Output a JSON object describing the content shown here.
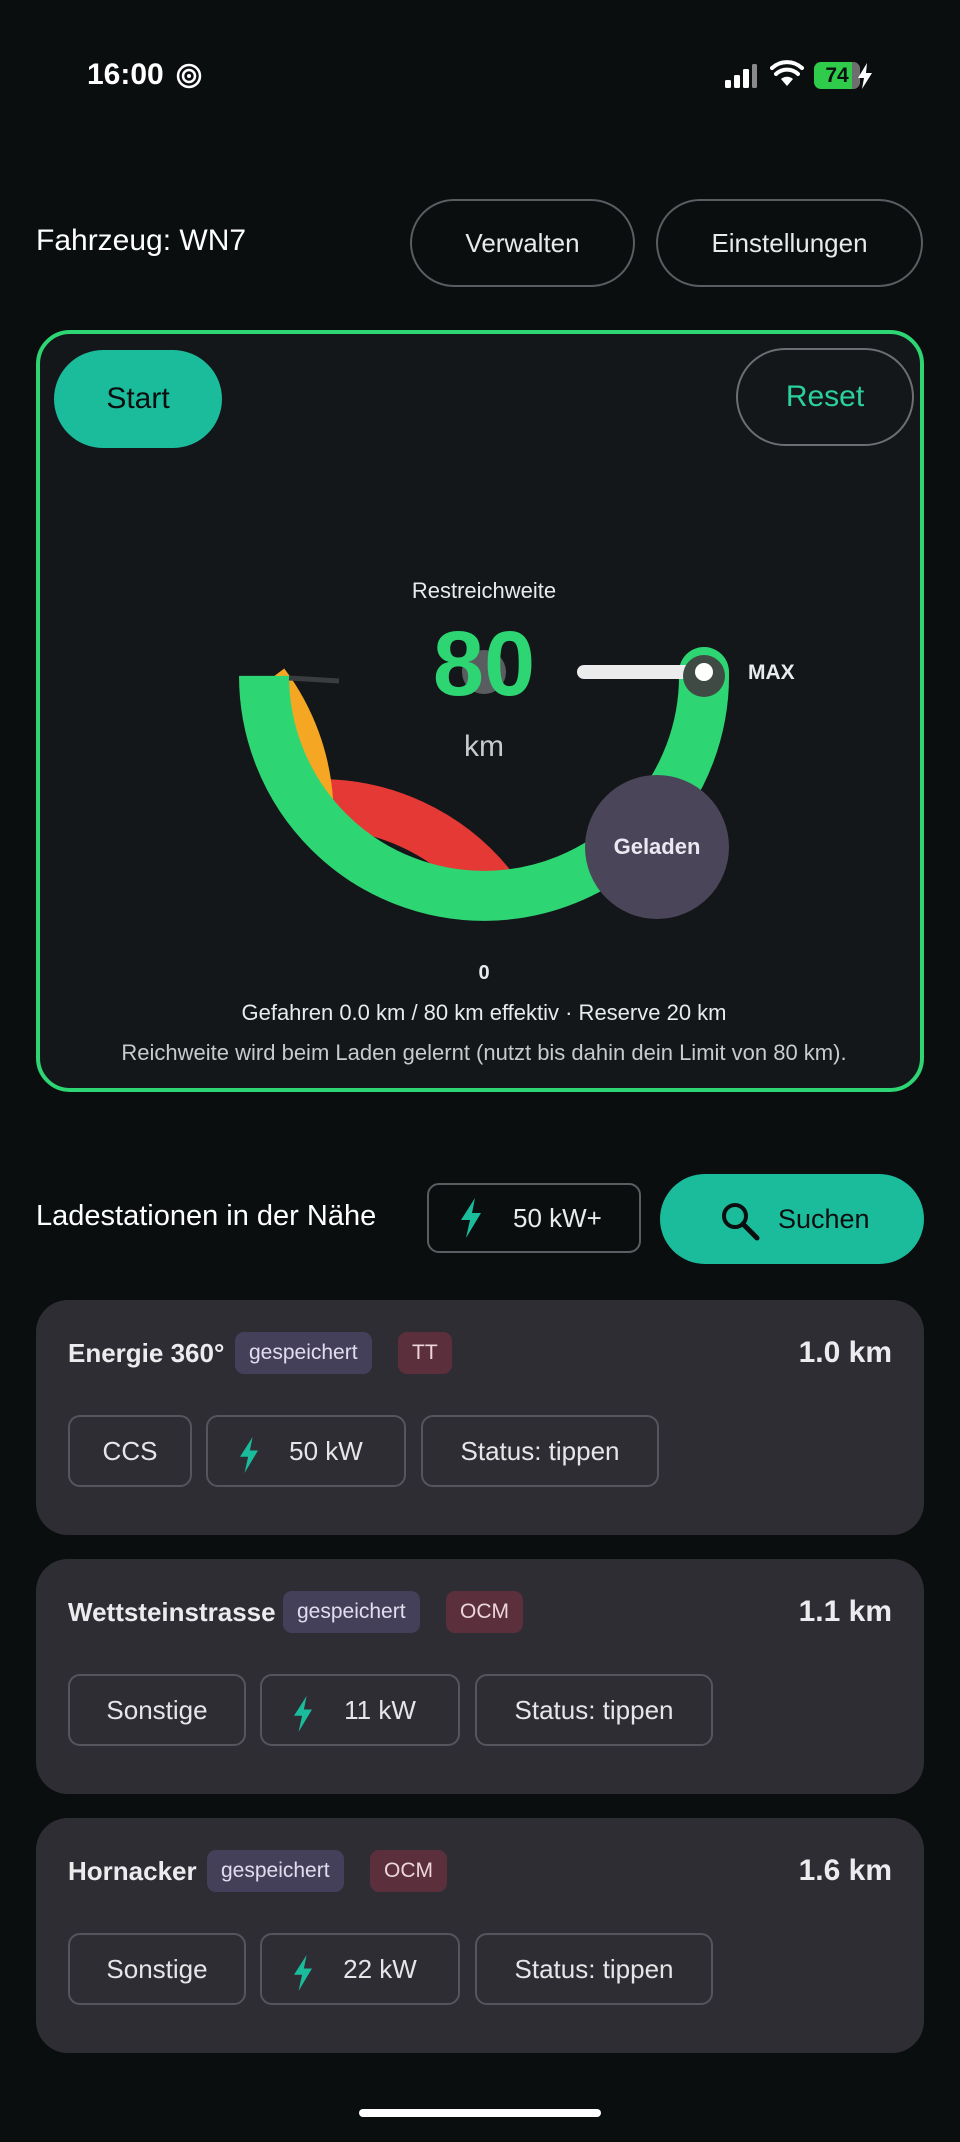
{
  "status_bar": {
    "time": "16:00",
    "battery": "74",
    "icons": [
      "dnd-icon",
      "signal-icon",
      "wifi-icon",
      "battery-icon",
      "charging-bolt-icon"
    ]
  },
  "header": {
    "vehicle_title": "Fahrzeug: WN7",
    "manage_label": "Verwalten",
    "settings_label": "Einstellungen"
  },
  "gauge": {
    "start_label": "Start",
    "reset_label": "Reset",
    "range_label": "Restreichweite",
    "range_value": "80",
    "range_unit": "km",
    "max_label": "MAX",
    "zero_label": "0",
    "charged_label": "Geladen",
    "driven_text": "Gefahren 0.0 km / 80 km effektiv · Reserve 20 km",
    "learn_text": "Reichweite wird beim Laden gelernt (nutzt bis dahin dein Limit von 80 km).",
    "range_fraction": 1.0,
    "zone_colors": {
      "green": "#2ed573",
      "orange": "#f5a623",
      "red": "#e53935"
    }
  },
  "nearby": {
    "title": "Ladestationen in der Nähe",
    "filter_label": "50 kW+",
    "search_label": "Suchen"
  },
  "stations": [
    {
      "name": "Energie 360°",
      "saved": "gespeichert",
      "source": "TT",
      "distance": "1.0 km",
      "plug": "CCS",
      "power": "50 kW",
      "status": "Status: tippen"
    },
    {
      "name": "Wettsteinstrasse",
      "saved": "gespeichert",
      "source": "OCM",
      "distance": "1.1 km",
      "plug": "Sonstige",
      "power": "11 kW",
      "status": "Status: tippen"
    },
    {
      "name": "Hornacker",
      "saved": "gespeichert",
      "source": "OCM",
      "distance": "1.6 km",
      "plug": "Sonstige",
      "power": "22 kW",
      "status": "Status: tippen"
    }
  ],
  "colors": {
    "accent": "#1abc9c",
    "gauge_border": "#2ed573",
    "background": "#0b0e0f",
    "card": "#2e2d33"
  }
}
